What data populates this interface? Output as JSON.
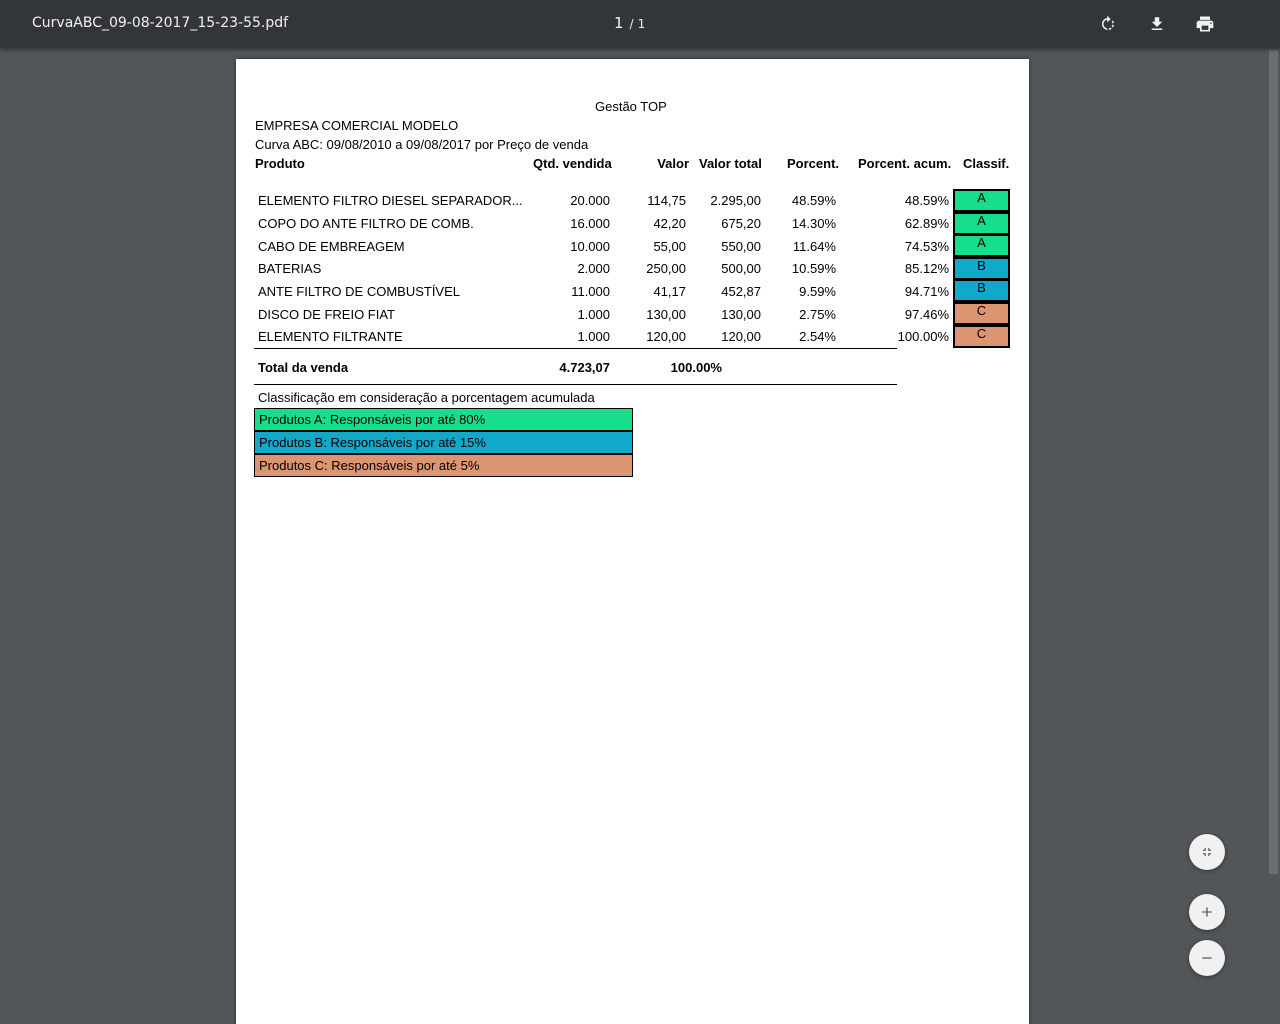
{
  "viewer": {
    "title": "CurvaABC_09-08-2017_15-23-55.pdf",
    "page_current": "1",
    "page_separator": "/",
    "page_total": "1"
  },
  "report": {
    "app_title": "Gestão TOP",
    "company": "EMPRESA COMERCIAL MODELO",
    "subtitle": "Curva ABC: 09/08/2010 a 09/08/2017 por Preço de venda",
    "headers": {
      "produto": "Produto",
      "qtd": "Qtd. vendida",
      "valor": "Valor",
      "valor_total": "Valor total",
      "porcent": "Porcent.",
      "porcent_acum": "Porcent. acum.",
      "classif": "Classif."
    },
    "rows": [
      {
        "produto": "ELEMENTO FILTRO DIESEL SEPARADOR...",
        "qtd": "20.000",
        "valor": "114,75",
        "valor_total": "2.295,00",
        "porcent": "48.59%",
        "porcent_acum": "48.59%",
        "classif": "A"
      },
      {
        "produto": "COPO DO ANTE FILTRO DE COMB.",
        "qtd": "16.000",
        "valor": "42,20",
        "valor_total": "675,20",
        "porcent": "14.30%",
        "porcent_acum": "62.89%",
        "classif": "A"
      },
      {
        "produto": "CABO DE EMBREAGEM",
        "qtd": "10.000",
        "valor": "55,00",
        "valor_total": "550,00",
        "porcent": "11.64%",
        "porcent_acum": "74.53%",
        "classif": "A"
      },
      {
        "produto": "BATERIAS",
        "qtd": "2.000",
        "valor": "250,00",
        "valor_total": "500,00",
        "porcent": "10.59%",
        "porcent_acum": "85.12%",
        "classif": "B"
      },
      {
        "produto": "ANTE FILTRO DE COMBUSTÍVEL",
        "qtd": "11.000",
        "valor": "41,17",
        "valor_total": "452,87",
        "porcent": "9.59%",
        "porcent_acum": "94.71%",
        "classif": "B"
      },
      {
        "produto": "DISCO DE FREIO FIAT",
        "qtd": "1.000",
        "valor": "130,00",
        "valor_total": "130,00",
        "porcent": "2.75%",
        "porcent_acum": "97.46%",
        "classif": "C"
      },
      {
        "produto": "ELEMENTO FILTRANTE",
        "qtd": "1.000",
        "valor": "120,00",
        "valor_total": "120,00",
        "porcent": "2.54%",
        "porcent_acum": "100.00%",
        "classif": "C"
      }
    ],
    "total": {
      "label": "Total da venda",
      "valor": "4.723,07",
      "porcent": "100.00%"
    },
    "legend_title": "Classificação em consideração a porcentagem acumulada",
    "legend": [
      {
        "label": "Produtos A: Responsáveis por até 80%",
        "class": "A"
      },
      {
        "label": "Produtos B: Responsáveis por até 15%",
        "class": "B"
      },
      {
        "label": "Produtos C: Responsáveis por até 5%",
        "class": "C"
      }
    ],
    "class_colors": {
      "A": "#17de8b",
      "B": "#11a9c9",
      "C": "#dd9470"
    }
  },
  "icons": {
    "rotate": "rotate-icon",
    "download": "download-icon",
    "print": "print-icon",
    "fit": "fit-page-icon",
    "zoom_in": "zoom-in-icon",
    "zoom_out": "zoom-out-icon"
  }
}
